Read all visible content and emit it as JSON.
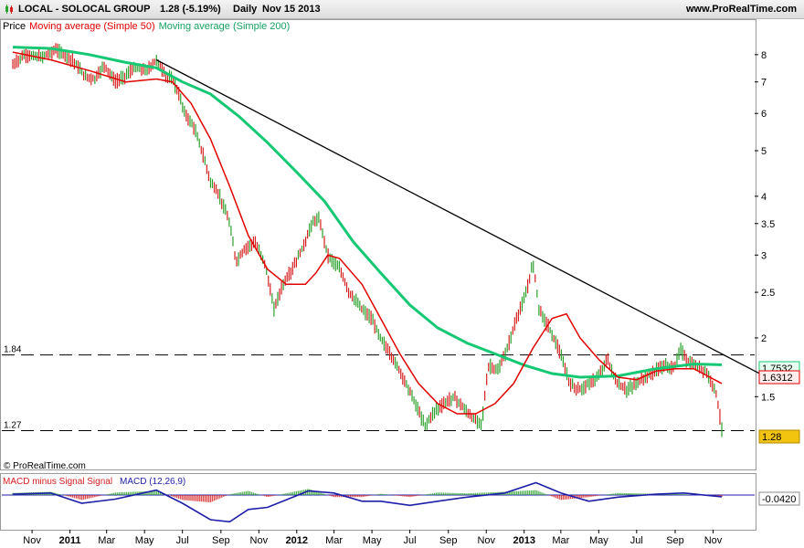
{
  "header": {
    "ticker": "LOCAL - SOLOCAL GROUP",
    "price_change": "1.28 (-5.19%)",
    "period": "Daily",
    "date": "Nov 15 2013",
    "site": "www.ProRealTime.com"
  },
  "legend": {
    "price": "Price",
    "ma50": "Moving average (Simple 50)",
    "ma200": "Moving average (Simple 200)",
    "macd_hist": "MACD minus Signal Signal",
    "macd": "MACD (12,26,9)"
  },
  "colors": {
    "ma50": "#e00000",
    "ma200": "#16c873",
    "up_bar": "#2ca02c",
    "down_bar": "#d62020",
    "macd_line": "#1e1ea8",
    "trendline": "#000000",
    "badge_last": "#f2c40f",
    "badge_ma200": "#e6fff0"
  },
  "copyright": "© ProRealTime.com",
  "chart_data": [
    {
      "type": "line",
      "panel": "price",
      "scale": "log",
      "ylim": [
        1.18,
        8.9
      ],
      "y_ticks": [
        8,
        7,
        6,
        5,
        4,
        3.5,
        3,
        2.5,
        2,
        1.5
      ],
      "x_tick_labels": [
        "Nov",
        "2011",
        "Mar",
        "May",
        "Jul",
        "Sep",
        "Nov",
        "2012",
        "Mar",
        "May",
        "Jul",
        "Sep",
        "Nov",
        "2013",
        "Mar",
        "May",
        "Jul",
        "Sep",
        "Nov"
      ],
      "bold_x_ticks": [
        "2011",
        "2012",
        "2013"
      ],
      "x_range": [
        "2010-10-01",
        "2013-11-15"
      ],
      "series": [
        {
          "name": "Price",
          "points": [
            [
              "2010-10-01",
              7.6
            ],
            [
              "2010-10-20",
              8.0
            ],
            [
              "2010-11-15",
              7.9
            ],
            [
              "2010-12-10",
              8.2
            ],
            [
              "2011-01-05",
              7.8
            ],
            [
              "2011-01-25",
              7.2
            ],
            [
              "2011-02-10",
              7.1
            ],
            [
              "2011-02-25",
              7.6
            ],
            [
              "2011-03-15",
              7.0
            ],
            [
              "2011-03-30",
              7.2
            ],
            [
              "2011-04-15",
              7.5
            ],
            [
              "2011-05-05",
              7.4
            ],
            [
              "2011-05-20",
              7.8
            ],
            [
              "2011-06-05",
              7.2
            ],
            [
              "2011-06-15",
              7.1
            ],
            [
              "2011-06-25",
              6.6
            ],
            [
              "2011-07-05",
              6.0
            ],
            [
              "2011-07-20",
              5.6
            ],
            [
              "2011-08-05",
              4.8
            ],
            [
              "2011-08-15",
              4.3
            ],
            [
              "2011-08-30",
              4.0
            ],
            [
              "2011-09-15",
              3.5
            ],
            [
              "2011-09-25",
              2.9
            ],
            [
              "2011-10-10",
              3.1
            ],
            [
              "2011-10-25",
              3.2
            ],
            [
              "2011-11-10",
              2.9
            ],
            [
              "2011-11-25",
              2.3
            ],
            [
              "2011-12-10",
              2.6
            ],
            [
              "2011-12-25",
              2.8
            ],
            [
              "2012-01-15",
              3.2
            ],
            [
              "2012-01-25",
              3.5
            ],
            [
              "2012-02-05",
              3.6
            ],
            [
              "2012-02-20",
              3.0
            ],
            [
              "2012-03-10",
              2.8
            ],
            [
              "2012-03-25",
              2.5
            ],
            [
              "2012-04-15",
              2.3
            ],
            [
              "2012-04-30",
              2.2
            ],
            [
              "2012-05-15",
              2.0
            ],
            [
              "2012-05-30",
              1.85
            ],
            [
              "2012-06-15",
              1.7
            ],
            [
              "2012-06-30",
              1.55
            ],
            [
              "2012-07-15",
              1.4
            ],
            [
              "2012-07-25",
              1.3
            ],
            [
              "2012-08-10",
              1.4
            ],
            [
              "2012-08-25",
              1.45
            ],
            [
              "2012-09-10",
              1.5
            ],
            [
              "2012-09-25",
              1.42
            ],
            [
              "2012-10-10",
              1.35
            ],
            [
              "2012-10-25",
              1.32
            ],
            [
              "2012-11-05",
              1.75
            ],
            [
              "2012-11-20",
              1.7
            ],
            [
              "2012-12-05",
              1.9
            ],
            [
              "2012-12-20",
              2.2
            ],
            [
              "2013-01-05",
              2.5
            ],
            [
              "2013-01-15",
              2.9
            ],
            [
              "2013-01-25",
              2.3
            ],
            [
              "2013-02-10",
              2.1
            ],
            [
              "2013-02-25",
              1.9
            ],
            [
              "2013-03-15",
              1.6
            ],
            [
              "2013-03-30",
              1.55
            ],
            [
              "2013-04-15",
              1.6
            ],
            [
              "2013-04-30",
              1.65
            ],
            [
              "2013-05-15",
              1.8
            ],
            [
              "2013-05-30",
              1.6
            ],
            [
              "2013-06-15",
              1.55
            ],
            [
              "2013-06-30",
              1.6
            ],
            [
              "2013-07-15",
              1.65
            ],
            [
              "2013-07-30",
              1.7
            ],
            [
              "2013-08-15",
              1.75
            ],
            [
              "2013-08-30",
              1.72
            ],
            [
              "2013-09-10",
              1.9
            ],
            [
              "2013-09-20",
              1.78
            ],
            [
              "2013-10-05",
              1.74
            ],
            [
              "2013-10-20",
              1.7
            ],
            [
              "2013-11-05",
              1.55
            ],
            [
              "2013-11-15",
              1.28
            ]
          ]
        },
        {
          "name": "Moving average (Simple 50)",
          "points": [
            [
              "2010-10-01",
              8.1
            ],
            [
              "2010-12-01",
              7.8
            ],
            [
              "2011-02-01",
              7.4
            ],
            [
              "2011-04-01",
              7.0
            ],
            [
              "2011-05-20",
              7.1
            ],
            [
              "2011-06-15",
              7.0
            ],
            [
              "2011-07-15",
              6.3
            ],
            [
              "2011-08-15",
              5.3
            ],
            [
              "2011-09-15",
              4.2
            ],
            [
              "2011-10-15",
              3.3
            ],
            [
              "2011-11-15",
              2.8
            ],
            [
              "2011-12-15",
              2.6
            ],
            [
              "2012-01-15",
              2.6
            ],
            [
              "2012-02-01",
              2.75
            ],
            [
              "2012-02-20",
              3.0
            ],
            [
              "2012-03-10",
              2.95
            ],
            [
              "2012-04-15",
              2.6
            ],
            [
              "2012-05-15",
              2.2
            ],
            [
              "2012-06-15",
              1.85
            ],
            [
              "2012-07-15",
              1.6
            ],
            [
              "2012-08-15",
              1.45
            ],
            [
              "2012-09-15",
              1.38
            ],
            [
              "2012-10-15",
              1.38
            ],
            [
              "2012-11-15",
              1.45
            ],
            [
              "2012-12-15",
              1.6
            ],
            [
              "2013-01-15",
              1.9
            ],
            [
              "2013-02-15",
              2.2
            ],
            [
              "2013-03-10",
              2.25
            ],
            [
              "2013-04-01",
              2.0
            ],
            [
              "2013-05-01",
              1.8
            ],
            [
              "2013-06-01",
              1.65
            ],
            [
              "2013-07-01",
              1.63
            ],
            [
              "2013-08-01",
              1.7
            ],
            [
              "2013-09-01",
              1.72
            ],
            [
              "2013-10-01",
              1.72
            ],
            [
              "2013-11-15",
              1.6
            ]
          ]
        },
        {
          "name": "Moving average (Simple 200)",
          "points": [
            [
              "2010-10-01",
              8.3
            ],
            [
              "2010-12-01",
              8.25
            ],
            [
              "2011-02-01",
              8.0
            ],
            [
              "2011-04-01",
              7.7
            ],
            [
              "2011-05-20",
              7.5
            ],
            [
              "2011-07-01",
              7.0
            ],
            [
              "2011-08-15",
              6.6
            ],
            [
              "2011-10-01",
              5.9
            ],
            [
              "2011-11-15",
              5.2
            ],
            [
              "2012-01-01",
              4.5
            ],
            [
              "2012-02-15",
              3.9
            ],
            [
              "2012-04-01",
              3.2
            ],
            [
              "2012-05-15",
              2.75
            ],
            [
              "2012-07-01",
              2.35
            ],
            [
              "2012-08-15",
              2.1
            ],
            [
              "2012-10-01",
              1.95
            ],
            [
              "2012-11-15",
              1.85
            ],
            [
              "2013-01-01",
              1.75
            ],
            [
              "2013-02-15",
              1.68
            ],
            [
              "2013-04-01",
              1.65
            ],
            [
              "2013-06-01",
              1.66
            ],
            [
              "2013-08-01",
              1.72
            ],
            [
              "2013-10-01",
              1.76
            ],
            [
              "2013-11-15",
              1.7532
            ]
          ]
        }
      ],
      "trendline": {
        "from": [
          "2011-05-20",
          7.8
        ],
        "to": [
          "2013-11-15",
          1.7
        ]
      },
      "hlines": [
        {
          "value": 1.84,
          "label": "1.84"
        },
        {
          "value": 1.27,
          "label": "1.27"
        }
      ],
      "price_badges": [
        {
          "text": "1.7532",
          "series": "Moving average (Simple 200)"
        },
        {
          "text": "1.6312",
          "series": "Moving average (Simple 50)"
        },
        {
          "text": "1.28",
          "series": "Price"
        }
      ]
    },
    {
      "type": "area",
      "panel": "macd",
      "legend": [
        "MACD minus Signal Signal",
        "MACD (12,26,9)"
      ],
      "last_value_label": "-0.0420",
      "series": [
        {
          "name": "MACD (12,26,9)",
          "points": [
            [
              "2010-10-01",
              0.02
            ],
            [
              "2010-12-01",
              0.05
            ],
            [
              "2011-01-20",
              -0.2
            ],
            [
              "2011-03-15",
              -0.1
            ],
            [
              "2011-05-20",
              0.12
            ],
            [
              "2011-07-01",
              -0.2
            ],
            [
              "2011-08-15",
              -0.6
            ],
            [
              "2011-09-15",
              -0.65
            ],
            [
              "2011-10-15",
              -0.35
            ],
            [
              "2011-11-15",
              -0.3
            ],
            [
              "2012-01-20",
              0.1
            ],
            [
              "2012-03-01",
              0.05
            ],
            [
              "2012-04-15",
              -0.15
            ],
            [
              "2012-05-15",
              -0.15
            ],
            [
              "2012-07-01",
              -0.25
            ],
            [
              "2012-08-15",
              -0.15
            ],
            [
              "2012-10-01",
              -0.05
            ],
            [
              "2012-12-01",
              0.05
            ],
            [
              "2013-01-20",
              0.3
            ],
            [
              "2013-03-01",
              0.05
            ],
            [
              "2013-04-15",
              -0.15
            ],
            [
              "2013-06-01",
              -0.05
            ],
            [
              "2013-08-01",
              0.02
            ],
            [
              "2013-09-15",
              0.05
            ],
            [
              "2013-11-15",
              -0.042
            ]
          ]
        },
        {
          "name": "MACD minus Signal Signal",
          "points": [
            [
              "2010-10-01",
              0.05
            ],
            [
              "2010-12-01",
              0.08
            ],
            [
              "2011-01-20",
              -0.12
            ],
            [
              "2011-03-15",
              0.06
            ],
            [
              "2011-05-20",
              0.1
            ],
            [
              "2011-07-01",
              -0.12
            ],
            [
              "2011-08-15",
              -0.18
            ],
            [
              "2011-09-15",
              0.02
            ],
            [
              "2011-10-15",
              0.1
            ],
            [
              "2011-11-15",
              -0.05
            ],
            [
              "2012-01-20",
              0.15
            ],
            [
              "2012-03-01",
              -0.05
            ],
            [
              "2012-04-15",
              -0.05
            ],
            [
              "2012-05-15",
              0.03
            ],
            [
              "2012-07-01",
              -0.05
            ],
            [
              "2012-08-15",
              0.06
            ],
            [
              "2012-10-01",
              0.04
            ],
            [
              "2012-12-01",
              0.08
            ],
            [
              "2013-01-20",
              0.12
            ],
            [
              "2013-03-01",
              -0.12
            ],
            [
              "2013-04-15",
              -0.05
            ],
            [
              "2013-06-01",
              0.05
            ],
            [
              "2013-08-01",
              0.03
            ],
            [
              "2013-09-15",
              0.02
            ],
            [
              "2013-11-15",
              -0.04
            ]
          ]
        }
      ]
    }
  ]
}
